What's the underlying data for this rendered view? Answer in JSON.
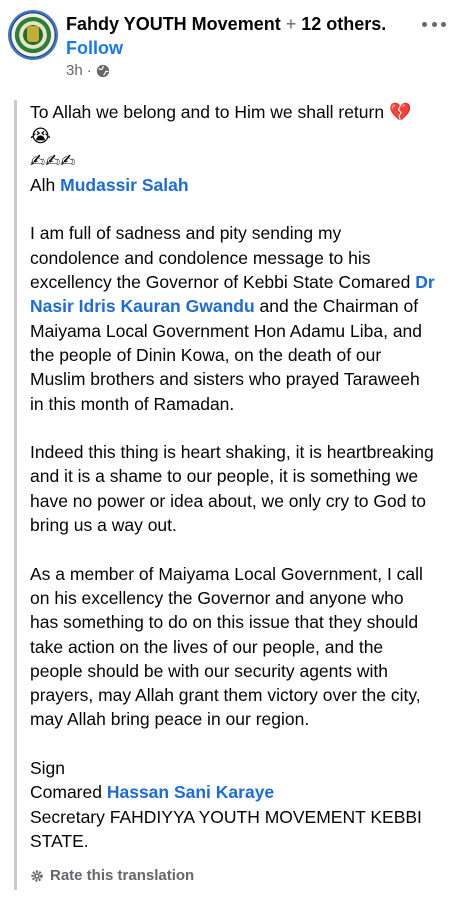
{
  "header": {
    "page_name": "Fahdy YOUTH Movement",
    "plus": "+",
    "others": "12 others.",
    "follow_label": "Follow",
    "time": "3h",
    "separator": "·"
  },
  "post": {
    "line1": "To Allah we belong and to Him we shall return",
    "emoji_heartbreak": "💔",
    "emoji_cry": "😭",
    "emoji_hands": "✍✍✍",
    "author_prefix": "Alh ",
    "author_name": "Mudassir Salah",
    "p1_a": "I am full of sadness and pity sending my condolence and condolence message to his excellency the Governor of Kebbi State Comared ",
    "p1_link": "Dr Nasir Idris Kauran Gwandu",
    "p1_b": " and the Chairman of Maiyama Local Government Hon Adamu Liba, and the people of Dinin Kowa, on the death of our Muslim brothers and sisters who prayed Taraweeh in this month of Ramadan.",
    "p2": "Indeed this thing is heart shaking, it is heartbreaking and it is a shame to our people, it is something we have no power or idea about, we only cry to God to bring us a way out.",
    "p3": "As a member of Maiyama Local Government, I call on his excellency the Governor and anyone who has something to do on this issue that they should take action on the lives of our people, and the people should be with our security agents with prayers, may Allah grant them victory over the city, may Allah bring peace in our region.",
    "sign": "Sign",
    "signer_prefix": "Comared ",
    "signer_name": "Hassan Sani Karaye",
    "signer_title": "Secretary FAHDIYYA YOUTH MOVEMENT KEBBI STATE."
  },
  "footer": {
    "rate_label": "Rate this translation"
  },
  "colors": {
    "link": "#1c6bd6",
    "follow": "#1877f2",
    "secondary": "#65676b"
  }
}
